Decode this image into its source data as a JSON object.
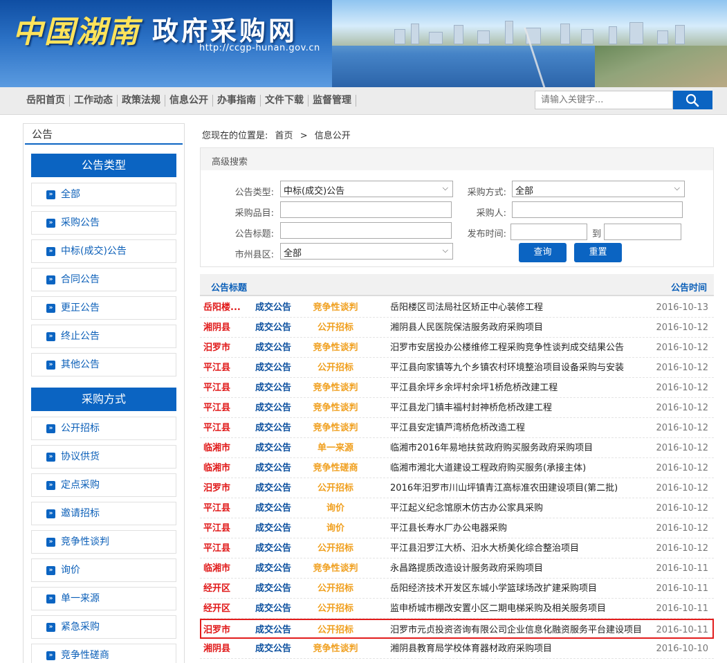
{
  "header": {
    "logo_text": "中国湖南",
    "site_title": "政府采购网",
    "url": "http://ccgp-hunan.gov.cn"
  },
  "nav": {
    "items": [
      "岳阳首页",
      "工作动态",
      "政策法规",
      "信息公开",
      "办事指南",
      "文件下载",
      "监督管理"
    ],
    "search_placeholder": "请输入关键字..."
  },
  "sidebar": {
    "title": "公告",
    "section1": "公告类型",
    "types": [
      "全部",
      "采购公告",
      "中标(成交)公告",
      "合同公告",
      "更正公告",
      "终止公告",
      "其他公告"
    ],
    "section2": "采购方式",
    "methods": [
      "公开招标",
      "协议供货",
      "定点采购",
      "邀请招标",
      "竞争性谈判",
      "询价",
      "单一来源",
      "紧急采购",
      "竞争性磋商"
    ]
  },
  "breadcrumb": {
    "prefix": "您现在的位置是:",
    "home": "首页",
    "sep": ">",
    "current": "信息公开"
  },
  "search_form": {
    "title": "高级搜索",
    "notice_type_label": "公告类型:",
    "notice_type_value": "中标(成交)公告",
    "method_label": "采购方式:",
    "method_value": "全部",
    "item_label": "采购品目:",
    "item_value": "",
    "buyer_label": "采购人:",
    "buyer_value": "",
    "title_label": "公告标题:",
    "title_value": "",
    "date_label": "发布时间:",
    "date_from": "",
    "date_to_label": "到",
    "date_to": "",
    "region_label": "市州县区:",
    "region_value": "全部",
    "query_button": "查询",
    "reset_button": "重置"
  },
  "list": {
    "col_title": "公告标题",
    "col_time": "公告时间",
    "rows": [
      {
        "area": "岳阳楼...",
        "type": "成交公告",
        "mode": "竞争性谈判",
        "title": "岳阳楼区司法局社区矫正中心装修工程",
        "date": "2016-10-13"
      },
      {
        "area": "湘阴县",
        "type": "成交公告",
        "mode": "公开招标",
        "title": "湘阴县人民医院保洁服务政府采购项目",
        "date": "2016-10-12"
      },
      {
        "area": "汨罗市",
        "type": "成交公告",
        "mode": "竞争性谈判",
        "title": "汨罗市安居投办公楼维修工程采购竞争性谈判成交结果公告",
        "date": "2016-10-12"
      },
      {
        "area": "平江县",
        "type": "成交公告",
        "mode": "公开招标",
        "title": "平江县向家镇等九个乡镇农村环境整治项目设备采购与安装",
        "date": "2016-10-12"
      },
      {
        "area": "平江县",
        "type": "成交公告",
        "mode": "竞争性谈判",
        "title": "平江县余坪乡余坪村余坪1桥危桥改建工程",
        "date": "2016-10-12"
      },
      {
        "area": "平江县",
        "type": "成交公告",
        "mode": "竞争性谈判",
        "title": "平江县龙门镇丰福村封神桥危桥改建工程",
        "date": "2016-10-12"
      },
      {
        "area": "平江县",
        "type": "成交公告",
        "mode": "竞争性谈判",
        "title": "平江县安定镇芦湾桥危桥改造工程",
        "date": "2016-10-12"
      },
      {
        "area": "临湘市",
        "type": "成交公告",
        "mode": "单一来源",
        "title": "临湘市2016年易地扶贫政府购买服务政府采购项目",
        "date": "2016-10-12"
      },
      {
        "area": "临湘市",
        "type": "成交公告",
        "mode": "竞争性磋商",
        "title": "临湘市湘北大道建设工程政府购买服务(承接主体)",
        "date": "2016-10-12"
      },
      {
        "area": "汨罗市",
        "type": "成交公告",
        "mode": "公开招标",
        "title": "2016年汨罗市川山坪镇青江高标准农田建设项目(第二批)",
        "date": "2016-10-12"
      },
      {
        "area": "平江县",
        "type": "成交公告",
        "mode": "询价",
        "title": "平江起义纪念馆原木仿古办公家具采购",
        "date": "2016-10-12"
      },
      {
        "area": "平江县",
        "type": "成交公告",
        "mode": "询价",
        "title": "平江县长寿水厂办公电器采购",
        "date": "2016-10-12"
      },
      {
        "area": "平江县",
        "type": "成交公告",
        "mode": "公开招标",
        "title": "平江县汨罗江大桥、汨水大桥美化综合整治项目",
        "date": "2016-10-12"
      },
      {
        "area": "临湘市",
        "type": "成交公告",
        "mode": "竞争性谈判",
        "title": "永昌路提质改造设计服务政府采购项目",
        "date": "2016-10-11"
      },
      {
        "area": "经开区",
        "type": "成交公告",
        "mode": "公开招标",
        "title": "岳阳经济技术开发区东城小学篮球场改扩建采购项目",
        "date": "2016-10-11"
      },
      {
        "area": "经开区",
        "type": "成交公告",
        "mode": "公开招标",
        "title": "监申桥城市棚改安置小区二期电梯采购及相关服务项目",
        "date": "2016-10-11"
      },
      {
        "area": "汨罗市",
        "type": "成交公告",
        "mode": "公开招标",
        "title": "汨罗市元贞投资咨询有限公司企业信息化融资服务平台建设项目",
        "date": "2016-10-11"
      },
      {
        "area": "湘阴县",
        "type": "成交公告",
        "mode": "竞争性谈判",
        "title": "湘阴县教育局学校体育器材政府采购项目",
        "date": "2016-10-10"
      }
    ]
  },
  "colors": {
    "brand_blue": "#0b64c2",
    "area_red": "#e01818",
    "type_navy": "#0b4f9e",
    "mode_orange": "#f0a020",
    "highlight_border": "#e21c1c"
  }
}
